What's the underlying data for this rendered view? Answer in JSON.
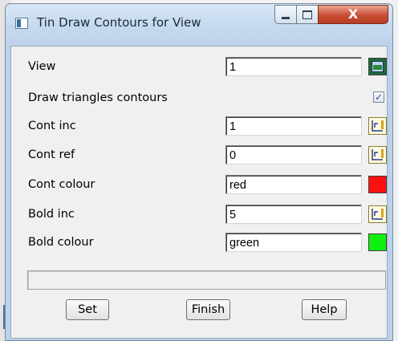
{
  "window": {
    "title": "Tin Draw Contours for View",
    "controls": {
      "minimize_icon": "minimize-icon",
      "maximize_icon": "maximize-icon",
      "close_label": "X"
    }
  },
  "form": {
    "view": {
      "label": "View",
      "value": "1",
      "icon": "view-picker-icon"
    },
    "draw_triangles": {
      "label": "Draw triangles contours",
      "checked": true,
      "check_mark": "✓"
    },
    "cont_inc": {
      "label": "Cont inc",
      "value": "1",
      "icon": "contour-interval-icon"
    },
    "cont_ref": {
      "label": "Cont ref",
      "value": "0",
      "icon": "contour-interval-icon"
    },
    "cont_colour": {
      "label": "Cont colour",
      "value": "red",
      "swatch_color": "#ff1010"
    },
    "bold_inc": {
      "label": "Bold inc",
      "value": "5",
      "icon": "contour-interval-icon"
    },
    "bold_colour": {
      "label": "Bold colour",
      "value": "green",
      "swatch_color": "#10f010"
    }
  },
  "status": {
    "text": ""
  },
  "buttons": {
    "set": "Set",
    "finish": "Finish",
    "help": "Help"
  }
}
